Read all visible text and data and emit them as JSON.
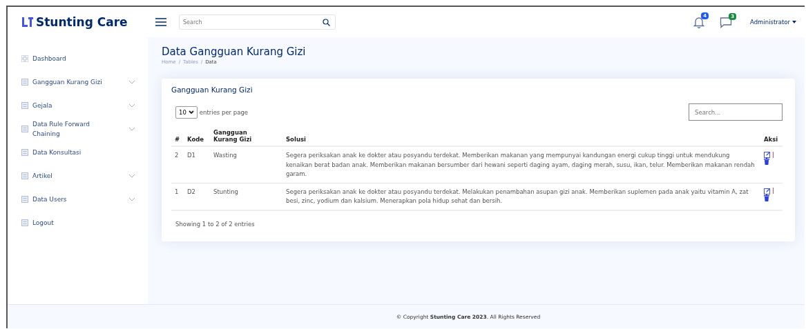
{
  "header": {
    "brand": "Stunting Care",
    "search": {
      "placeholder": "Search"
    },
    "notifications": [
      {
        "count": "4",
        "color": "#1e5cf0"
      },
      {
        "count": "3",
        "color": "#198a3e"
      }
    ],
    "user": "Administrator"
  },
  "sidebar": {
    "items": [
      {
        "label": "Dashboard",
        "has_submenu": false
      },
      {
        "label": "Gangguan Kurang Gizi",
        "has_submenu": true
      },
      {
        "label": "Gejala",
        "has_submenu": true
      },
      {
        "label": "Data Rule Forward Chaining",
        "has_submenu": true
      },
      {
        "label": "Data Konsultasi",
        "has_submenu": false
      },
      {
        "label": "Artikel",
        "has_submenu": true
      },
      {
        "label": "Data Users",
        "has_submenu": true
      },
      {
        "label": "Logout",
        "has_submenu": false
      }
    ]
  },
  "page": {
    "title": "Data Gangguan Kurang Gizi",
    "breadcrumb": [
      "Home",
      "Tables",
      "Data"
    ],
    "breadcrumb_separator": "/"
  },
  "card": {
    "title": "Gangguan Kurang Gizi",
    "per_page": "10",
    "per_page_label": "entries per page",
    "search": {
      "placeholder": "Search..."
    },
    "table": {
      "columns": [
        "#",
        "Kode",
        "Gangguan Kurang Gizi",
        "Solusi",
        "Aksi"
      ],
      "rows": [
        {
          "cells": [
            "2",
            "D1",
            "Wasting",
            "Segera periksakan anak ke dokter atau posyandu terdekat. Memberikan makanan yang mempunyai kandungan energi cukup tinggi untuk mendukung kenaikan berat badan anak. Memberikan makanan bersumber dari hewani seperti daging ayam, daging merah, susu, ikan, telur. Memberikan makanan rendah garam."
          ]
        },
        {
          "cells": [
            "1",
            "D2",
            "Stunting",
            "Segera periksakan anak ke dokter atau posyandu terdekat. Melakukan penambahan asupan gizi anak. Memberikan suplemen pada anak yaitu vitamin A, zat besi, zinc, yodium dan kalsium. Menerapkan pola hidup sehat dan bersih."
          ]
        }
      ]
    },
    "info": "Showing 1 to 2 of 2 entries"
  },
  "footer": "© Copyright **Stunting Care 2023**. All Rights Reserved"
}
